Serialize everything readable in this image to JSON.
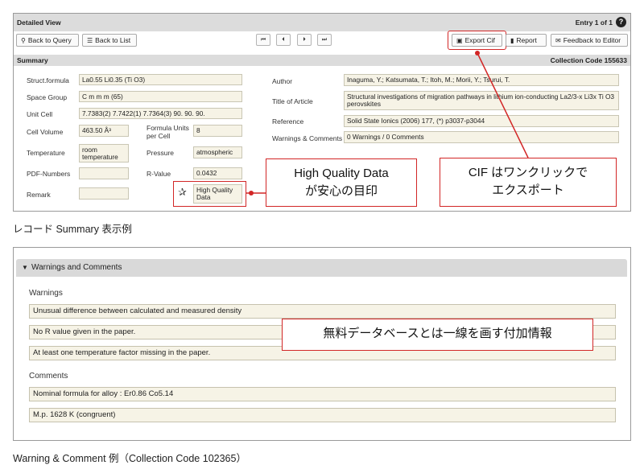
{
  "detail": {
    "header_title": "Detailed View",
    "entry_info": "Entry 1 of 1",
    "help_glyph": "?",
    "buttons": {
      "back_to_query": "Back to Query",
      "back_to_list": "Back to List",
      "export_cif": "Export Cif",
      "report": "Report",
      "feedback": "Feedback to Editor"
    },
    "nav": {
      "first": "⏮",
      "prev": "⏴",
      "next": "⏵",
      "last": "⏭"
    },
    "summary_title": "Summary",
    "collection_code": "Collection Code 155633",
    "labels": {
      "struct_formula": "Struct.formula",
      "space_group": "Space Group",
      "unit_cell": "Unit Cell",
      "cell_volume": "Cell Volume",
      "formula_units": "Formula Units per Cell",
      "temperature": "Temperature",
      "pressure": "Pressure",
      "pdf_numbers": "PDF-Numbers",
      "r_value": "R-Value",
      "remark": "Remark",
      "author": "Author",
      "title_of_article": "Title of Article",
      "reference": "Reference",
      "warnings_comments": "Warnings & Comments"
    },
    "values": {
      "struct_formula": "La0.55 Li0.35 (Ti O3)",
      "space_group": "C m m m (65)",
      "unit_cell": "7.7383(2) 7.7422(1) 7.7364(3) 90. 90. 90.",
      "cell_volume": "463.50 Å³",
      "formula_units": "8",
      "temperature": "room temperature",
      "pressure": "atmospheric",
      "pdf_numbers": "",
      "r_value": "0.0432",
      "remark": "",
      "high_quality": "High Quality Data",
      "author": "Inaguma, Y.; Katsumata, T.; Itoh, M.; Morii, Y.; Tsurui, T.",
      "title_of_article": "Structural investigations of migration pathways in lithium ion-conducting La2/3-x Li3x Ti O3 perovskites",
      "reference": "Solid State Ionics (2006) 177, (*) p3037-p3044",
      "warnings_comments": "0 Warnings / 0 Comments"
    }
  },
  "callouts": {
    "high_quality": "High Quality Data\nが安心の目印",
    "cif": "CIF はワンクリックで\nエクスポート",
    "free_db": "無料データベースとは一線を画す付加情報"
  },
  "caption1": "レコード Summary 表示例",
  "warnings_panel": {
    "title": "Warnings and Comments",
    "warnings_label": "Warnings",
    "warnings": [
      "Unusual difference between calculated and measured density",
      "No R value given in the paper.",
      "At least one temperature factor missing in the paper."
    ],
    "comments_label": "Comments",
    "comments": [
      "Nominal formula for alloy : Er0.86 Co5.14",
      "M.p. 1628 K (congruent)"
    ]
  },
  "caption2": "Warning & Comment 例（Collection Code 102365）",
  "colors": {
    "callout": "#d22626",
    "field_bg": "#f6f3e6",
    "bar_bg": "#dcdcdc"
  }
}
